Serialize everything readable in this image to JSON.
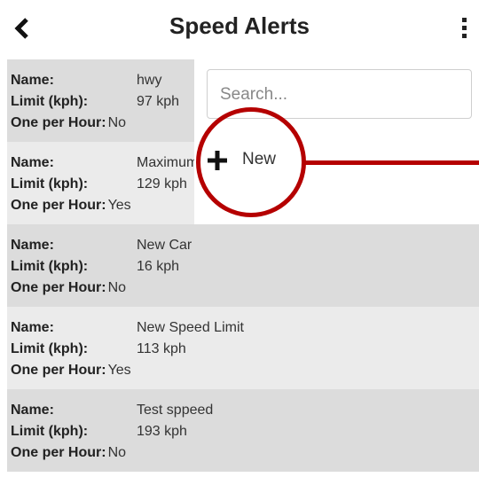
{
  "header": {
    "title": "Speed Alerts",
    "back_icon": "chevron-left-icon",
    "menu_icon": "kebab-menu-icon"
  },
  "labels": {
    "name": "Name:",
    "limit": "Limit (kph):",
    "one_per_hour": "One per Hour:"
  },
  "alerts": [
    {
      "name": "hwy",
      "limit": "97 kph",
      "one_per_hour": "No"
    },
    {
      "name": "Maximum",
      "limit": "129 kph",
      "one_per_hour": "Yes"
    },
    {
      "name": "New Car",
      "limit": "16 kph",
      "one_per_hour": "No"
    },
    {
      "name": "New Speed Limit",
      "limit": "113 kph",
      "one_per_hour": "Yes"
    },
    {
      "name": "Test sppeed",
      "limit": "193 kph",
      "one_per_hour": "No"
    }
  ],
  "search": {
    "placeholder": "Search..."
  },
  "new_button": {
    "label": "New",
    "icon": "plus-icon"
  },
  "colors": {
    "annotation": "#b50000",
    "row_dark": "#dcdcdc",
    "row_light": "#ebebeb"
  }
}
